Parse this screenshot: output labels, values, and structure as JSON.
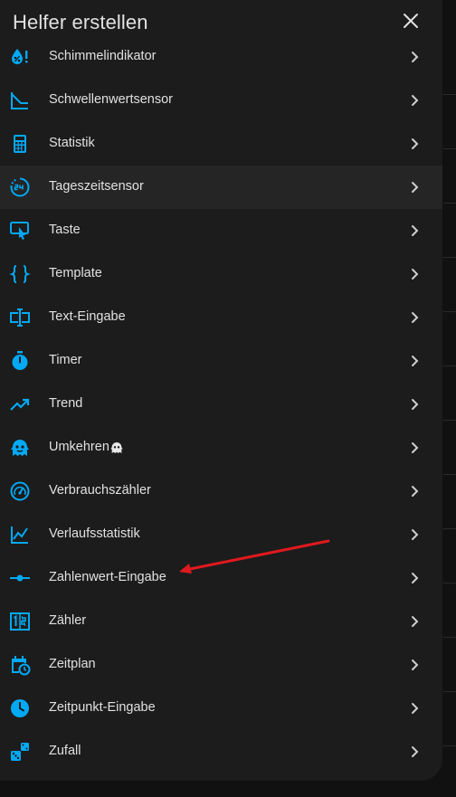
{
  "dialog": {
    "title": "Helfer erstellen"
  },
  "items": [
    {
      "label": "Schimmelindikator",
      "icon": "mold-indicator-icon"
    },
    {
      "label": "Schwellenwertsensor",
      "icon": "threshold-icon"
    },
    {
      "label": "Statistik",
      "icon": "calculator-icon"
    },
    {
      "label": "Tageszeitsensor",
      "icon": "hours-24-icon"
    },
    {
      "label": "Taste",
      "icon": "button-pointer-icon"
    },
    {
      "label": "Template",
      "icon": "code-braces-icon"
    },
    {
      "label": "Text-Eingabe",
      "icon": "text-input-icon"
    },
    {
      "label": "Timer",
      "icon": "timer-icon"
    },
    {
      "label": "Trend",
      "icon": "trending-up-icon"
    },
    {
      "label": "Umkehren",
      "icon": "ghost-icon"
    },
    {
      "label": "Verbrauchszähler",
      "icon": "gauge-icon"
    },
    {
      "label": "Verlaufsstatistik",
      "icon": "chart-line-icon"
    },
    {
      "label": "Zahlenwert-Eingabe",
      "icon": "slider-icon"
    },
    {
      "label": "Zähler",
      "icon": "counter-icon"
    },
    {
      "label": "Zeitplan",
      "icon": "calendar-clock-icon"
    },
    {
      "label": "Zeitpunkt-Eingabe",
      "icon": "clock-icon"
    },
    {
      "label": "Zufall",
      "icon": "dice-icon"
    }
  ],
  "colors": {
    "accent": "#03a9f4",
    "text": "#e1e1e1",
    "annotation": "#e0191e"
  }
}
